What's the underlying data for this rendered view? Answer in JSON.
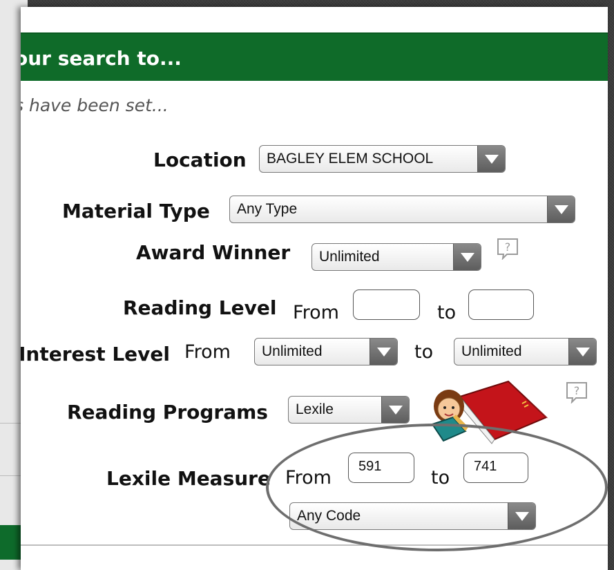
{
  "dialog": {
    "title": "our search to...",
    "subtitle": "s have been set..."
  },
  "fields": {
    "location": {
      "label": "Location",
      "value": "BAGLEY ELEM SCHOOL"
    },
    "material_type": {
      "label": "Material Type",
      "value": "Any Type"
    },
    "award_winner": {
      "label": "Award Winner",
      "value": "Unlimited"
    },
    "reading_level": {
      "label": "Reading Level",
      "from_word": "From",
      "to_word": "to",
      "from_value": "",
      "to_value": ""
    },
    "interest_level": {
      "label": "Interest Level",
      "from_word": "From",
      "to_word": "to",
      "from_value": "Unlimited",
      "to_value": "Unlimited"
    },
    "reading_programs": {
      "label": "Reading Programs",
      "value": "Lexile"
    },
    "lexile_measure": {
      "label": "Lexile Measure",
      "from_word": "From",
      "to_word": "to",
      "from_value": "591",
      "to_value": "741",
      "code_value": "Any Code"
    }
  },
  "icons": {
    "help": "help-icon",
    "reading_mascot": "reading-girl-book-icon",
    "dropdown_arrow": "chevron-down-icon"
  },
  "colors": {
    "header_green": "#0f6b29",
    "background_frame": "#3d3d3d",
    "annotation_ring": "#6e6e6e"
  }
}
